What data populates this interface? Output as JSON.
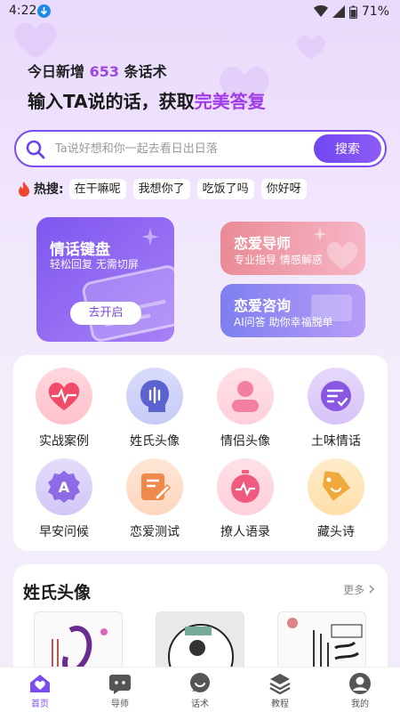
{
  "status_bar": {
    "time": "4:22",
    "battery": "71%"
  },
  "hero": {
    "line1_prefix": "今日新增",
    "count": "653",
    "line1_suffix": "条话术",
    "line2_prefix": "输入TA说的话，获取",
    "line2_highlight": "完美答复"
  },
  "search": {
    "placeholder": "Ta说好想和你一起去看日出日落",
    "button": "搜索"
  },
  "hot": {
    "label": "热搜:",
    "tags": [
      "在干嘛呢",
      "我想你了",
      "吃饭了吗",
      "你好呀"
    ]
  },
  "cards": {
    "keyboard": {
      "title": "情话键盘",
      "subtitle": "轻松回复 无需切屏",
      "button": "去开启"
    },
    "mentor": {
      "title": "恋爱导师",
      "subtitle": "专业指导 情感解惑"
    },
    "consult": {
      "title": "恋爱咨询",
      "subtitle": "AI问答 助你幸福脱单"
    }
  },
  "grid": [
    {
      "label": "实战案例",
      "icon": "heart-pulse-icon"
    },
    {
      "label": "姓氏头像",
      "icon": "head-voice-icon"
    },
    {
      "label": "情侣头像",
      "icon": "person-icon"
    },
    {
      "label": "土味情话",
      "icon": "chat-check-icon"
    },
    {
      "label": "早安问候",
      "icon": "letter-a-badge-icon"
    },
    {
      "label": "恋爱测试",
      "icon": "edit-note-icon"
    },
    {
      "label": "撩人语录",
      "icon": "heart-timer-icon"
    },
    {
      "label": "藏头诗",
      "icon": "tag-smile-icon"
    }
  ],
  "section": {
    "title": "姓氏头像",
    "more": "更多"
  },
  "nav": [
    {
      "label": "首页",
      "icon": "home-heart-icon",
      "active": true
    },
    {
      "label": "导师",
      "icon": "chat-bubble-icon",
      "active": false
    },
    {
      "label": "话术",
      "icon": "speech-icon",
      "active": false
    },
    {
      "label": "教程",
      "icon": "layers-icon",
      "active": false
    },
    {
      "label": "我的",
      "icon": "profile-icon",
      "active": false
    }
  ],
  "colors": {
    "accent": "#7b4df0",
    "highlight": "#a13be8"
  }
}
